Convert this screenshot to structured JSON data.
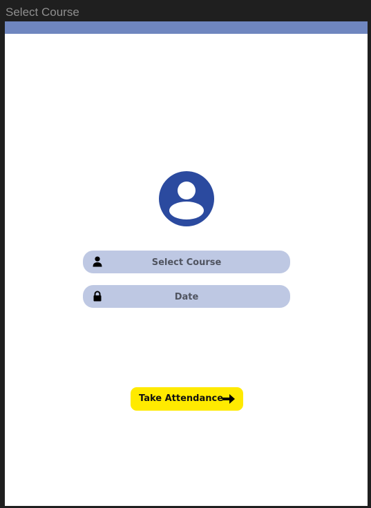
{
  "window": {
    "title": "Select Course"
  },
  "colors": {
    "appbar": "#6f86bf",
    "avatar": "#2b4a9f",
    "field_bg": "#bec8e3",
    "button_bg": "#ffea00"
  },
  "avatar": {
    "icon": "account-circle-icon"
  },
  "form": {
    "course_field": {
      "icon": "person-icon",
      "placeholder": "Select Course"
    },
    "date_field": {
      "icon": "lock-icon",
      "placeholder": "Date"
    }
  },
  "take_attendance_button": {
    "label": "Take Attendance",
    "icon": "arrow-right-icon"
  }
}
